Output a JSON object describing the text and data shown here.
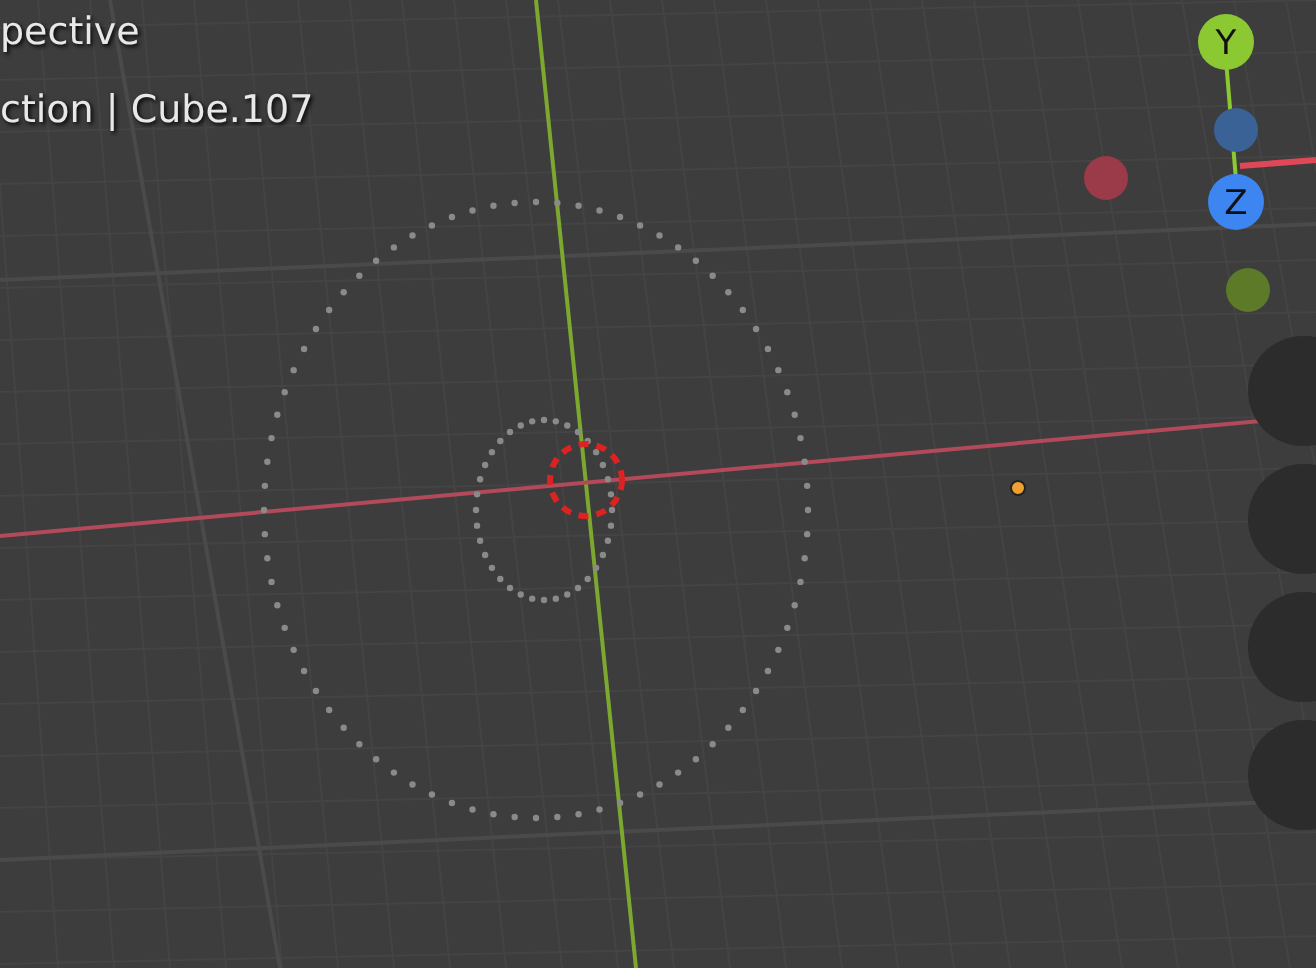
{
  "viewport": {
    "view_label": "pective",
    "object_label": "ction | Cube.107"
  },
  "gizmo": {
    "axes": [
      {
        "label": "Y",
        "kind": "labeled",
        "color": "#8cc832"
      },
      {
        "label": "Z",
        "kind": "labeled",
        "color": "#3d85f0"
      }
    ]
  }
}
